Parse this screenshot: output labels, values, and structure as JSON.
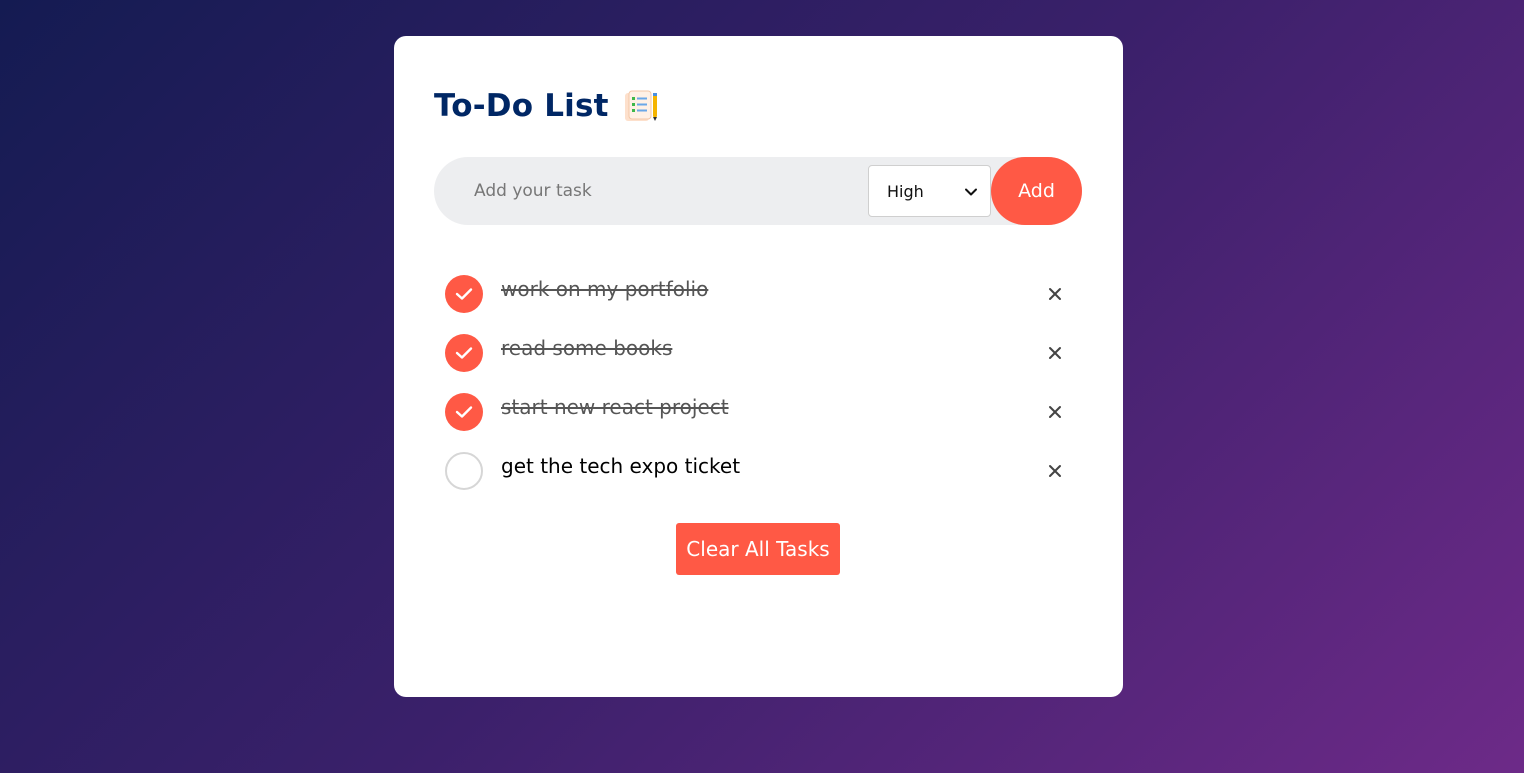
{
  "app": {
    "title": "To-Do List",
    "title_icon": "notepad-icon"
  },
  "form": {
    "input_placeholder": "Add your task",
    "input_value": "",
    "priority_selected": "High",
    "add_label": "Add"
  },
  "tasks": [
    {
      "text": "work on my portfolio",
      "completed": true
    },
    {
      "text": "read some books",
      "completed": true
    },
    {
      "text": "start new react project",
      "completed": true
    },
    {
      "text": "get the tech expo ticket",
      "completed": false
    }
  ],
  "clear_label": "Clear All Tasks",
  "colors": {
    "accent": "#ff5945",
    "title": "#002765",
    "input_bg": "#edeef0",
    "background_start": "#141b52",
    "background_end": "#6d2a88"
  }
}
